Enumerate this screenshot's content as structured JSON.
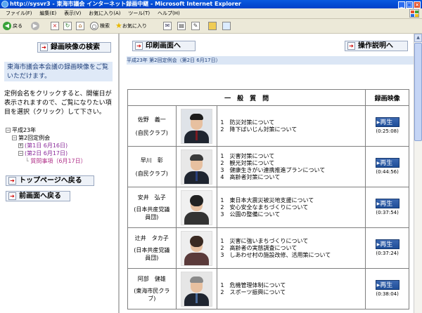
{
  "window": {
    "title": "http://sysvr3 - 東海市議会 インターネット録画中継 - Microsoft Internet Explorer",
    "buttons": [
      "_",
      "□",
      "×"
    ]
  },
  "menu": [
    "ファイル(F)",
    "編集(E)",
    "表示(V)",
    "お気に入り(A)",
    "ツール(T)",
    "ヘルプ(H)"
  ],
  "toolbar": {
    "back": "戻る",
    "search": "検索",
    "favorites": "お気に入り"
  },
  "left": {
    "search_btn": "録画映像の検索",
    "info": "東海市議会本会議の録画映像をご覧いただけます。",
    "instructions": "定例会名をクリックすると、開催日が表示されますので、ご覧になりたい項目を選択（クリック）して下さい。",
    "tree": {
      "year": "平成23年",
      "session": "第2回定例会",
      "day1": "(第1日 6月16日)",
      "day2": "(第2日 6月17日)",
      "item": "質問事項（6月17日）"
    },
    "top_btn": "トップページへ戻る",
    "prev_btn": "前画面へ戻る"
  },
  "right": {
    "print_btn": "印刷画面へ",
    "help_btn": "操作説明へ",
    "session_label": "平成23年 第2回定例会（第2日 6月17日）",
    "table_head": "一　般　質　問",
    "video_head": "録画映像",
    "play_label": "再生",
    "rows": [
      {
        "name": "佐野　義一",
        "party": "(自民クラブ)",
        "q1": "1　防災対策について",
        "q2": "2　降下ばいじん対策について",
        "q3": "",
        "q4": "",
        "duration": "(0:25:08)"
      },
      {
        "name": "早川　彰",
        "party": "(自民クラブ)",
        "q1": "1　災害対策について",
        "q2": "2　観光対策について",
        "q3": "3　健康生きがい連携推進プランについて",
        "q4": "4　高齢者対策について",
        "duration": "(0:44:56)"
      },
      {
        "name": "安井　弘子",
        "party": "(日本共産党議員団)",
        "q1": "1　東日本大震災被災地支援について",
        "q2": "2　安心安全なまちづくりについて",
        "q3": "3　公園の整備について",
        "q4": "",
        "duration": "(0:37:54)"
      },
      {
        "name": "辻井　タカ子",
        "party": "(日本共産党議員団)",
        "q1": "1　災害に強いまちづくりについて",
        "q2": "2　高齢者の実態調査について",
        "q3": "3　しあわせ村の施設改修、活用策について",
        "q4": "",
        "duration": "(0:37:24)"
      },
      {
        "name": "阿部　健雄",
        "party": "(東海市民クラブ)",
        "q1": "1　危機管理体制について",
        "q2": "2　スポーツ振興について",
        "q3": "",
        "q4": "",
        "duration": "(0:38:04)"
      }
    ]
  }
}
